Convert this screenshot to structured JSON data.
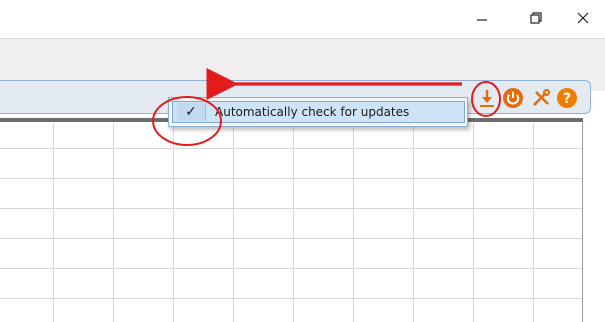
{
  "window": {
    "minimize_icon": "minimize-icon",
    "restore_icon": "restore-icon",
    "close_icon": "close-icon"
  },
  "toolbar": {
    "icons": [
      "download-update-icon",
      "power-icon",
      "tools-icon",
      "help-icon"
    ]
  },
  "menu": {
    "item_label": "Automatically check for updates",
    "checked": true,
    "check_glyph": "✓"
  },
  "colors": {
    "download": "#e36c0a",
    "power": "#e36c0a",
    "tools": "#e36c0a",
    "help": "#f07d00",
    "annotation": "#e21c1c"
  }
}
